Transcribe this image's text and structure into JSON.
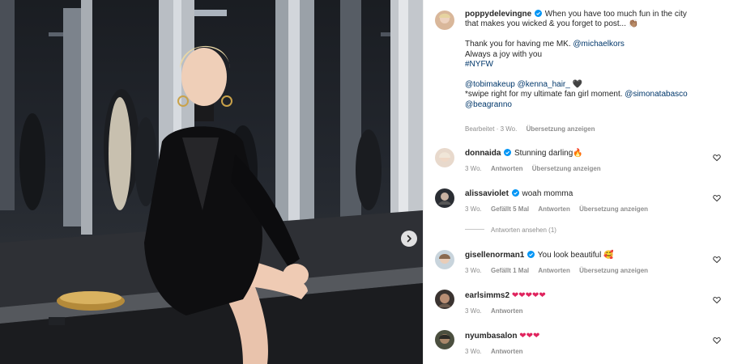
{
  "post": {
    "author": "poppydelevingne",
    "caption_lines": [
      "When you have too much fun in the city",
      "that makes you wicked & you forget to post...",
      "Thank you for having me MK.",
      "@michaelkors",
      "Always a joy with you",
      "#NYFW",
      "@tobimakeup @kenna_hair_",
      "*swipe right for my ultimate fan girl moment.",
      "@simonatabasco",
      "@beagranno"
    ],
    "meta": {
      "edited": "Bearbeitet · 3 Wo.",
      "translate": "Übersetzung anzeigen"
    }
  },
  "comments": [
    {
      "user": "donnaida",
      "verified": true,
      "text": "Stunning darling",
      "emoji": "🔥",
      "time": "3 Wo.",
      "likes": "",
      "reply": "Antworten",
      "translate": "Übersetzung anzeigen"
    },
    {
      "user": "alissaviolet",
      "verified": true,
      "text": "woah momma",
      "emoji": "",
      "time": "3 Wo.",
      "likes": "Gefällt 5 Mal",
      "reply": "Antworten",
      "translate": "Übersetzung anzeigen",
      "view_replies": "Antworten ansehen (1)"
    },
    {
      "user": "gisellenorman1",
      "verified": true,
      "text": "You look beautiful",
      "emoji": "🥰",
      "time": "3 Wo.",
      "likes": "Gefällt 1 Mal",
      "reply": "Antworten",
      "translate": "Übersetzung anzeigen"
    },
    {
      "user": "earlsimms2",
      "verified": false,
      "text": "",
      "emoji": "❤❤❤❤❤",
      "time": "3 Wo.",
      "likes": "",
      "reply": "Antworten",
      "translate": ""
    },
    {
      "user": "nyumbasalon",
      "verified": false,
      "text": "",
      "emoji": "❤❤❤",
      "time": "3 Wo.",
      "likes": "",
      "reply": "Antworten",
      "translate": ""
    }
  ],
  "colors": {
    "link": "#00376b",
    "verified": "#0095f6",
    "meta": "#8e8e8e",
    "heart_emoji": "#e0245e"
  },
  "icons": {
    "carousel_next": "chevron-right-icon",
    "like": "heart-outline-icon",
    "verified": "verified-badge-icon"
  }
}
